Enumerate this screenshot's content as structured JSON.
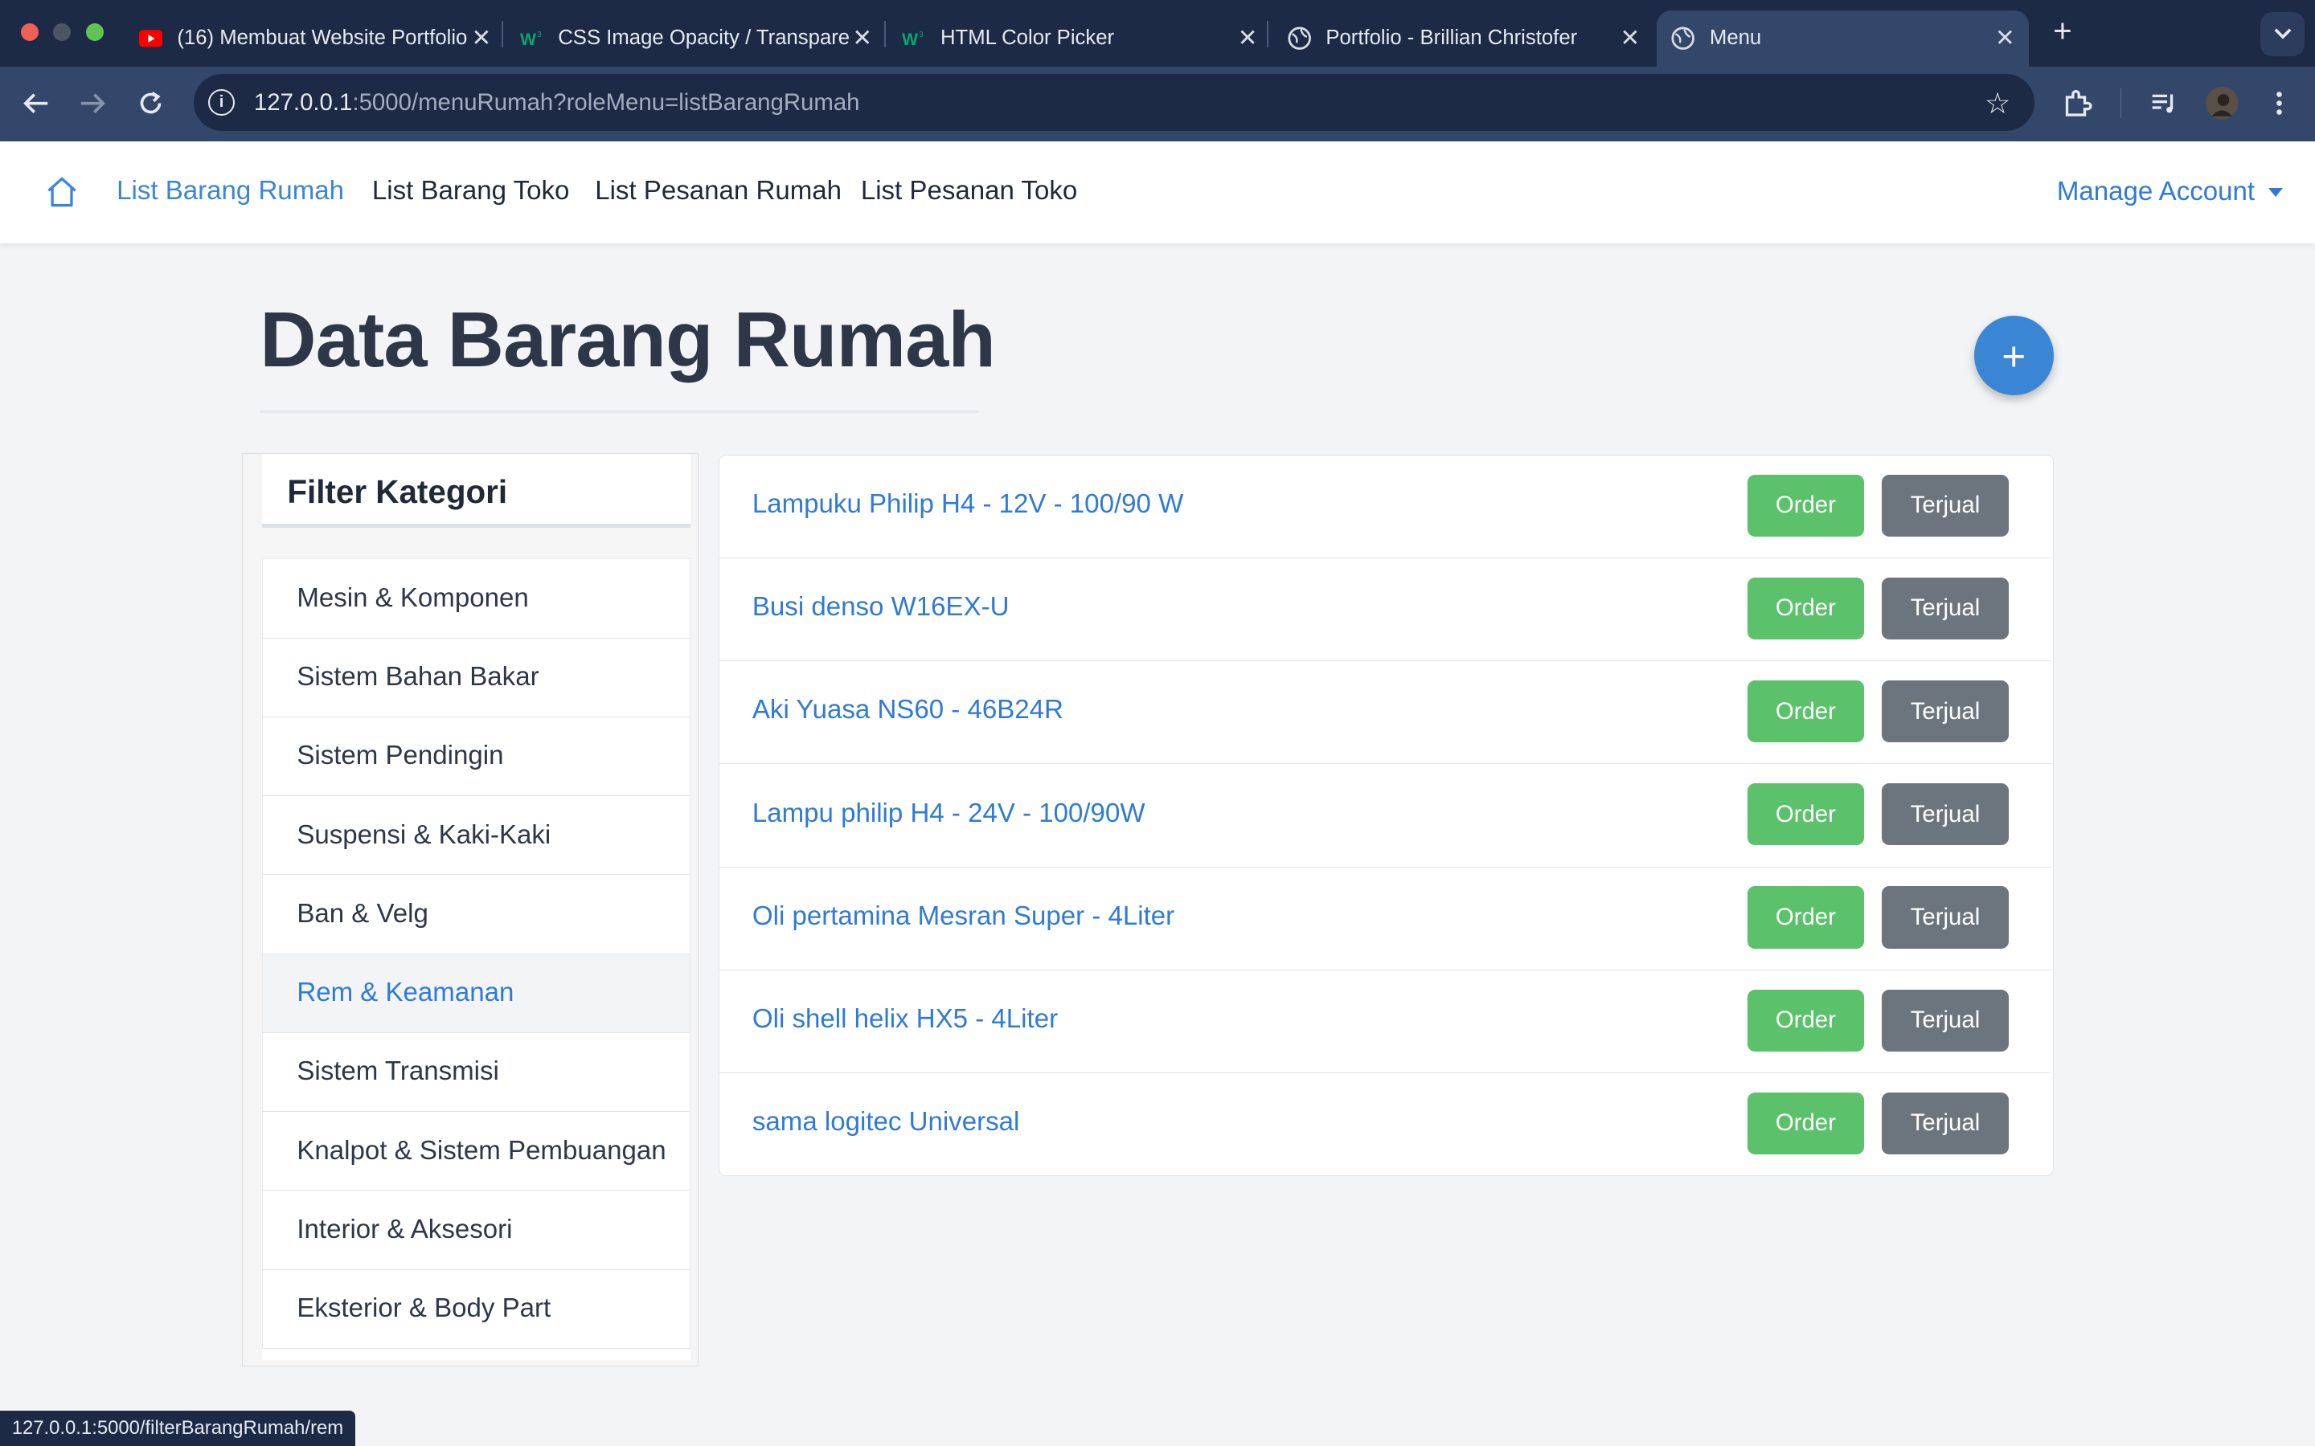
{
  "browser": {
    "tabs": [
      {
        "title": "(16) Membuat Website Portfolio",
        "icon": "youtube-icon",
        "active": false
      },
      {
        "title": "CSS Image Opacity / Transparency",
        "icon": "w3schools-icon",
        "active": false
      },
      {
        "title": "HTML Color Picker",
        "icon": "w3schools-icon",
        "active": false
      },
      {
        "title": "Portfolio - Brillian Christofer",
        "icon": "globe-icon",
        "active": false
      },
      {
        "title": "Menu",
        "icon": "globe-icon",
        "active": true
      }
    ],
    "url_host": "127.0.0.1",
    "url_rest": ":5000/menuRumah?roleMenu=listBarangRumah",
    "status_url": "127.0.0.1:5000/filterBarangRumah/rem"
  },
  "nav": {
    "links": [
      "List Barang Rumah",
      "List Barang Toko",
      "List Pesanan Rumah",
      "List Pesanan Toko"
    ],
    "manage_account": "Manage Account"
  },
  "page": {
    "title": "Data Barang Rumah",
    "add_button": "+"
  },
  "filter": {
    "heading": "Filter Kategori",
    "items": [
      "Mesin & Komponen",
      "Sistem Bahan Bakar",
      "Sistem Pendingin",
      "Suspensi & Kaki-Kaki",
      "Ban & Velg",
      "Rem & Keamanan",
      "Sistem Transmisi",
      "Knalpot & Sistem Pembuangan",
      "Interior & Aksesori",
      "Eksterior & Body Part"
    ],
    "hovered": "Rem & Keamanan"
  },
  "products": {
    "order_label": "Order",
    "sold_label": "Terjual",
    "items": [
      "Lampuku Philip H4 - 12V - 100/90 W",
      "Busi denso W16EX-U",
      "Aki Yuasa NS60 - 46B24R",
      "Lampu philip H4 - 24V - 100/90W",
      "Oli pertamina Mesran Super - 4Liter",
      "Oli shell helix HX5 - 4Liter",
      "sama logitec Universal"
    ]
  },
  "colors": {
    "accent": "#3a86d4",
    "link": "#2f7ad6",
    "order": "#5cc16b",
    "sold": "#6c757d",
    "chrome_dark": "#1c2a45",
    "chrome_mid": "#33476a"
  }
}
